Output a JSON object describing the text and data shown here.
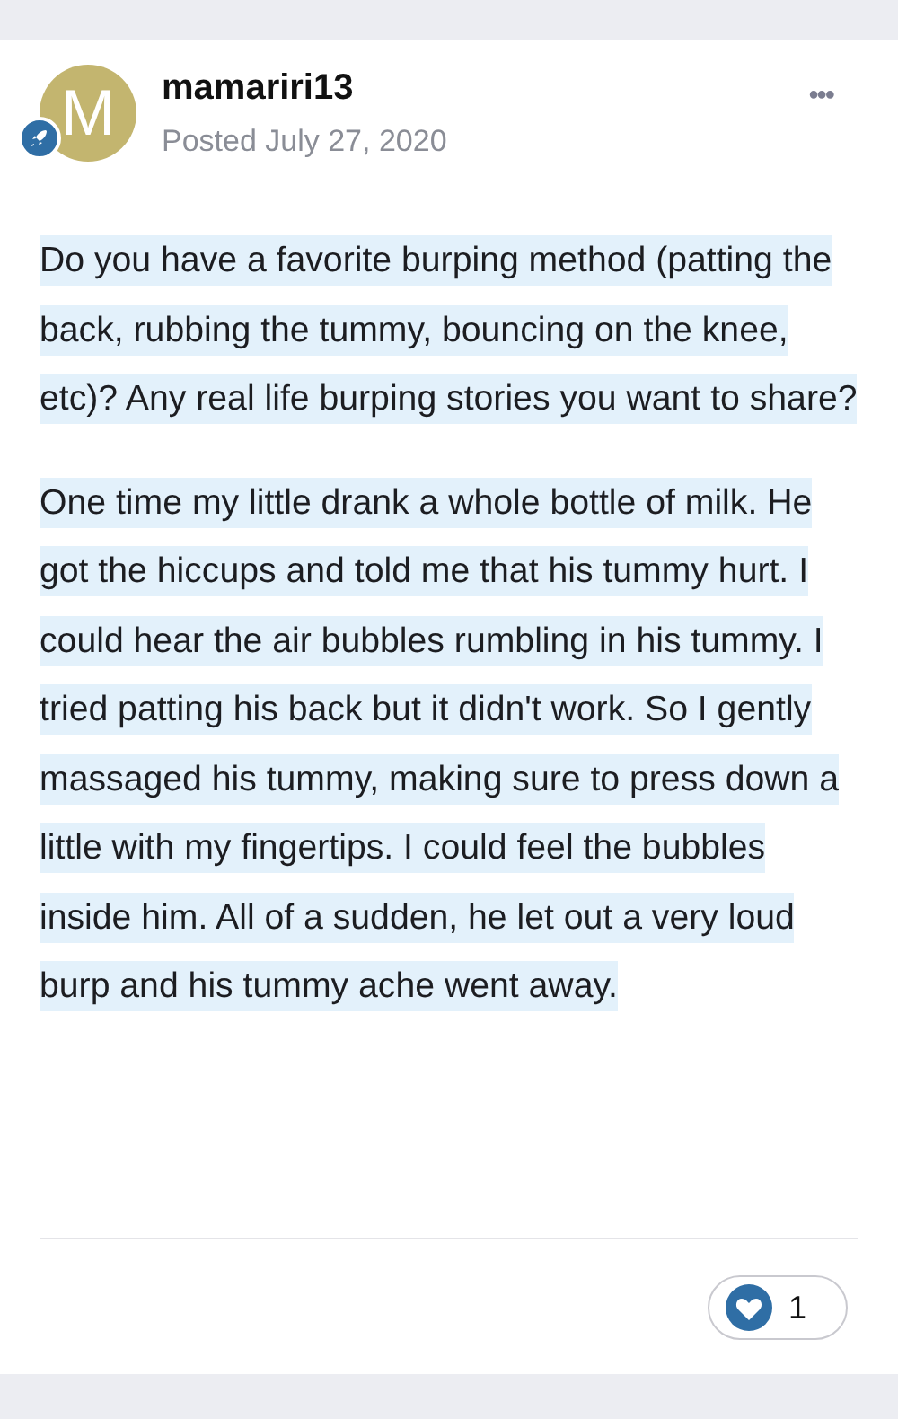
{
  "post": {
    "avatar_letter": "M",
    "author": "mamariri13",
    "posted": "Posted July 27, 2020",
    "menu": "•••",
    "paragraphs": [
      {
        "text": "Do you have a favorite burping method (patting the back, rubbing the tummy, bouncing on the knee, etc)? Any real life burping stories you want to share?",
        "highlighted": true
      },
      {
        "text": "One time my little drank a whole bottle of milk. He got the hiccups and told me that his tummy hurt. I could hear the air bubbles rumbling in his tummy. I tried patting his back but it didn't work. So I gently massaged his tummy, making sure to press down a little with my fingertips. I could feel the bubbles inside him. All of a sudden, he let out a very loud burp and his tummy ache went away.",
        "highlighted": true
      }
    ],
    "reactions": {
      "count": "1"
    }
  }
}
